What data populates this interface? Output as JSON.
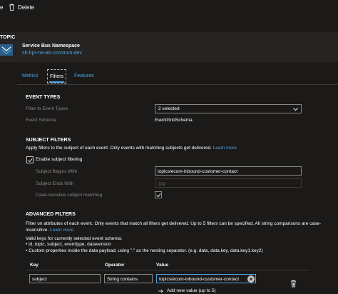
{
  "toolbar": {
    "cut_text": "e",
    "delete_label": "Delete"
  },
  "resource": {
    "type_label": "TOPIC",
    "title": "Service Bus Namespace",
    "name": "sb-hpr-ne-aic-common-dev"
  },
  "tabs": [
    {
      "label": "Metrics"
    },
    {
      "label": "Filters"
    },
    {
      "label": "Features"
    }
  ],
  "event_types": {
    "title": "EVENT TYPES",
    "filter_label": "Filter to Event Types",
    "filter_value": "2 selected",
    "schema_label": "Event Schema",
    "schema_value": "EventGridSchema"
  },
  "subject_filters": {
    "title": "SUBJECT FILTERS",
    "description": "Apply filters to the subject of each event. Only events with matching subjects get delivered.",
    "learn_more": "Learn more",
    "enable_label": "Enable subject filtering",
    "enable_checked": true,
    "begins_with_label": "Subject Begins With",
    "begins_with_value": "topics/ecom-inbound-customer-contact",
    "ends_with_label": "Subject Ends With",
    "ends_with_placeholder": ".jpg",
    "case_sensitive_label": "Case-sensitive subject matching",
    "case_sensitive_checked": true
  },
  "advanced_filters": {
    "title": "ADVANCED FILTERS",
    "description": "Filter on attributes of each event. Only events that match all filters get delivered. Up to 5 filters can be specified. All string comparisons are case-insensitive.",
    "learn_more": "Learn more",
    "valid_keys_intro": "Valid keys for currently selected event schema:",
    "bullets": [
      "id, topic, subject, eventtype, dataversion",
      "Custom properties inside the data payload, using \".\" as the nesting separator. (e.g. data, data.key, data.key1.key2)"
    ],
    "columns": {
      "key": "Key",
      "operator": "Operator",
      "value": "Value"
    },
    "row": {
      "key": "subject",
      "operator": "String contains",
      "value": "topics/ecom-inbound-customer-contact"
    },
    "add_new": "Add new value (up to 5)"
  },
  "colors": {
    "accent": "#4fa3e0",
    "background": "#1b1a19",
    "panel": "#252423"
  },
  "icons": [
    "trash-icon",
    "chevron-down-icon",
    "checkmark-icon",
    "service-bus-icon",
    "remove-tag-icon",
    "arrow-right-icon"
  ]
}
